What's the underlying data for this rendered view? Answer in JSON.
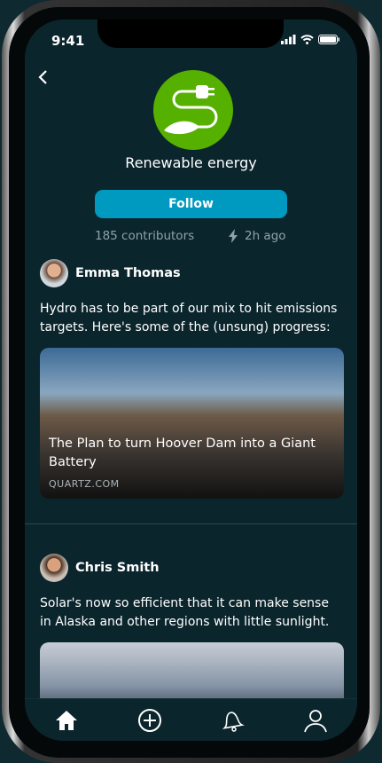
{
  "status": {
    "time": "9:41"
  },
  "topic": {
    "title": "Renewable energy",
    "follow_label": "Follow",
    "contributors": "185 contributors",
    "updated": "2h ago",
    "logo_color": "#56b000"
  },
  "posts": [
    {
      "author": "Emma Thomas",
      "text": "Hydro has to be part of our mix to hit emissions targets. Here's some of the (unsung) progress:",
      "card_title": "The Plan to turn Hoover Dam into a Giant Battery",
      "card_source": "QUARTZ.COM"
    },
    {
      "author": "Chris Smith",
      "text": "Solar's now so efficient that it can make sense in Alaska and other regions with little sunlight."
    }
  ],
  "tabbar": {
    "items": [
      "home-icon",
      "add-icon",
      "bell-icon",
      "profile-icon"
    ],
    "active": "home-icon"
  }
}
